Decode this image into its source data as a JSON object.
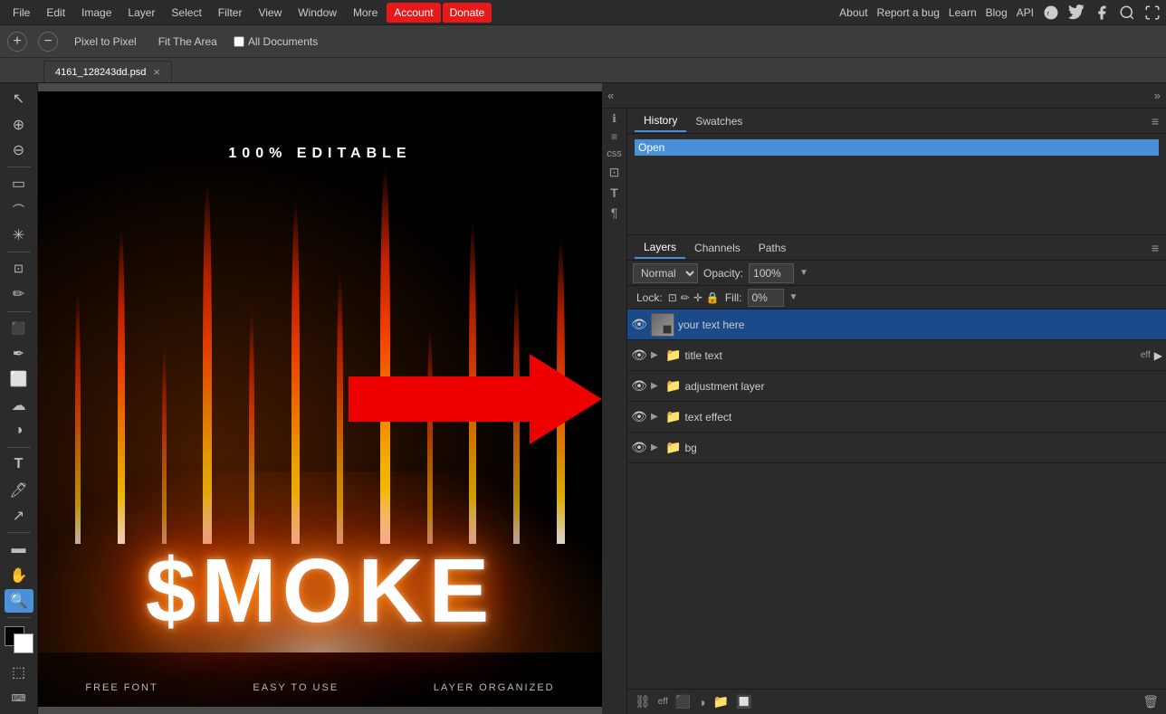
{
  "menubar": {
    "items": [
      "File",
      "Edit",
      "Image",
      "Layer",
      "Select",
      "Filter",
      "View",
      "Window",
      "More",
      "Account",
      "Donate"
    ],
    "right_items": [
      "About",
      "Report a bug",
      "Learn",
      "Blog",
      "API"
    ],
    "active": "Account",
    "donate": "Donate"
  },
  "toolbar": {
    "zoom_in": "+",
    "zoom_out": "−",
    "pixel_to_pixel": "Pixel to Pixel",
    "fit_area": "Fit The Area",
    "all_docs_label": "All Documents"
  },
  "tab": {
    "name": "4161_128243dd.psd",
    "close": "×"
  },
  "left_tools": [
    {
      "id": "zoom",
      "symbol": "🔍"
    },
    {
      "id": "plus",
      "symbol": "+"
    },
    {
      "id": "minus",
      "symbol": "−"
    },
    {
      "id": "select-rect",
      "symbol": "▭"
    },
    {
      "id": "select-lasso",
      "symbol": "⌒"
    },
    {
      "id": "select-magic",
      "symbol": "✳"
    },
    {
      "id": "crop",
      "symbol": "⊡"
    },
    {
      "id": "eyedropper",
      "symbol": "✏"
    },
    {
      "id": "paint-bucket",
      "symbol": "🪣"
    },
    {
      "id": "brush",
      "symbol": "✏"
    },
    {
      "id": "eraser",
      "symbol": "⬜"
    },
    {
      "id": "smudge",
      "symbol": "☁"
    },
    {
      "id": "dodge",
      "symbol": "◑"
    },
    {
      "id": "text",
      "symbol": "T"
    },
    {
      "id": "pen",
      "symbol": "🖊"
    },
    {
      "id": "move",
      "symbol": "↖"
    },
    {
      "id": "shape-rect",
      "symbol": "▭"
    },
    {
      "id": "hand",
      "symbol": "✋"
    },
    {
      "id": "magnifier",
      "symbol": "🔍"
    }
  ],
  "canvas": {
    "top_text": "100% EDITABLE",
    "smoke_text": "$MOKE",
    "bottom_labels": [
      "FREE FONT",
      "EASY TO USE",
      "LAYER ORGANIZED"
    ]
  },
  "history_panel": {
    "tab1": "History",
    "tab2": "Swatches",
    "items": [
      "Open"
    ]
  },
  "layers_panel": {
    "tabs": [
      "Layers",
      "Channels",
      "Paths"
    ],
    "blend_mode": "Normal",
    "opacity_label": "Opacity:",
    "opacity_value": "100%",
    "lock_label": "Lock:",
    "fill_label": "Fill:",
    "fill_value": "0%",
    "layers": [
      {
        "id": "your-text-here",
        "name": "your text here",
        "visible": true,
        "selected": true,
        "type": "text",
        "has_effect": false,
        "expandable": false
      },
      {
        "id": "title-text",
        "name": "title text",
        "visible": true,
        "selected": false,
        "type": "group",
        "has_effect": true,
        "eff_label": "eff",
        "expandable": true
      },
      {
        "id": "adjustment-layer",
        "name": "adjustment layer",
        "visible": true,
        "selected": false,
        "type": "group",
        "has_effect": false,
        "expandable": true
      },
      {
        "id": "text-effect",
        "name": "text effect",
        "visible": true,
        "selected": false,
        "type": "group",
        "has_effect": false,
        "expandable": true
      },
      {
        "id": "bg",
        "name": "bg",
        "visible": true,
        "selected": false,
        "type": "group",
        "has_effect": false,
        "expandable": true
      }
    ]
  },
  "bottom_bar": {
    "icons": [
      "⛓",
      "eff",
      "🔒",
      "◑",
      "📁",
      "🔲",
      "🗑"
    ]
  },
  "icons": {
    "eye": "👁",
    "folder": "📁",
    "lock": "🔒",
    "move": "✛",
    "link": "⛓",
    "arrow_right": "▶",
    "menu": "≡",
    "close": "×",
    "info": "ℹ",
    "properties": "⚙",
    "css": "css",
    "image_adjust": "⊡",
    "text_tool": "T",
    "paragraph": "¶"
  }
}
